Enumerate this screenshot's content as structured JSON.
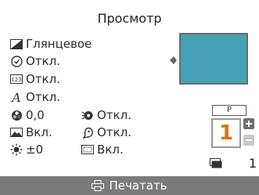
{
  "screen": {
    "title": "Просмотр"
  },
  "settings_left": [
    {
      "icon": "paper-gloss-icon",
      "value": "Глянцевое"
    },
    {
      "icon": "clock-date-icon",
      "value": "Откл."
    },
    {
      "icon": "file-number-icon",
      "value": "Откл."
    },
    {
      "icon": "font-style-icon",
      "value": "Откл."
    },
    {
      "icon": "color-tone-icon",
      "value": "0,0"
    },
    {
      "icon": "image-optimize-icon",
      "value": "Вкл."
    },
    {
      "icon": "brightness-icon",
      "value": "±0"
    }
  ],
  "settings_right": [
    {
      "icon": "red-eye-icon",
      "value": "Откл."
    },
    {
      "icon": "face-smoothing-icon",
      "value": "Откл."
    },
    {
      "icon": "border-frame-icon",
      "value": "Вкл."
    }
  ],
  "print": {
    "size_label": "P",
    "copies": "1",
    "total_count": "1"
  },
  "footer": {
    "button_label": "Печатать"
  },
  "colors": {
    "preview_fill": "#46a0b4",
    "copies_text": "#e07010",
    "footer_bg": "#7b7b7b"
  }
}
